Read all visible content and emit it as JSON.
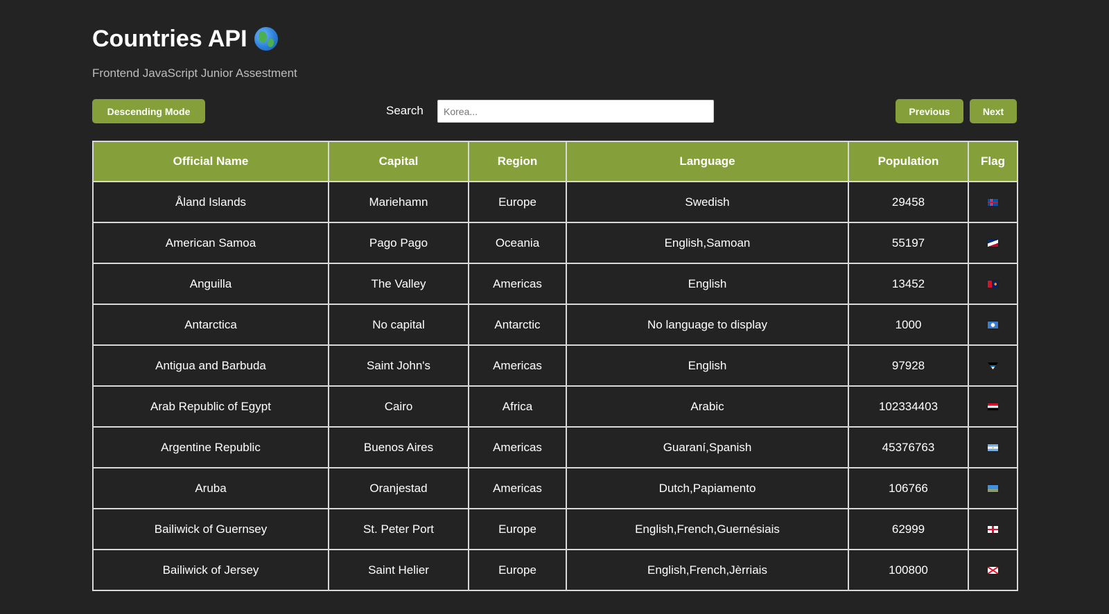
{
  "header": {
    "title": "Countries API",
    "globe_icon": "globe-americas-icon",
    "subtitle": "Frontend JavaScript Junior Assestment"
  },
  "controls": {
    "sort_button_label": "Descending Mode",
    "search_label": "Search",
    "search_placeholder": "Korea...",
    "search_value": "",
    "previous_label": "Previous",
    "next_label": "Next"
  },
  "colors": {
    "accent": "#85a03a",
    "background": "#232323",
    "border": "#d9d9d9"
  },
  "table": {
    "columns": [
      "Official Name",
      "Capital",
      "Region",
      "Language",
      "Population",
      "Flag"
    ],
    "rows": [
      {
        "name": "Åland Islands",
        "capital": "Mariehamn",
        "region": "Europe",
        "language": "Swedish",
        "population": "29458",
        "flag": "aland-flag-icon"
      },
      {
        "name": "American Samoa",
        "capital": "Pago Pago",
        "region": "Oceania",
        "language": "English,Samoan",
        "population": "55197",
        "flag": "american-samoa-flag-icon"
      },
      {
        "name": "Anguilla",
        "capital": "The Valley",
        "region": "Americas",
        "language": "English",
        "population": "13452",
        "flag": "anguilla-flag-icon"
      },
      {
        "name": "Antarctica",
        "capital": "No capital",
        "region": "Antarctic",
        "language": "No language to display",
        "population": "1000",
        "flag": "antarctica-flag-icon"
      },
      {
        "name": "Antigua and Barbuda",
        "capital": "Saint John's",
        "region": "Americas",
        "language": "English",
        "population": "97928",
        "flag": "antigua-barbuda-flag-icon"
      },
      {
        "name": "Arab Republic of Egypt",
        "capital": "Cairo",
        "region": "Africa",
        "language": "Arabic",
        "population": "102334403",
        "flag": "egypt-flag-icon"
      },
      {
        "name": "Argentine Republic",
        "capital": "Buenos Aires",
        "region": "Americas",
        "language": "Guaraní,Spanish",
        "population": "45376763",
        "flag": "argentina-flag-icon"
      },
      {
        "name": "Aruba",
        "capital": "Oranjestad",
        "region": "Americas",
        "language": "Dutch,Papiamento",
        "population": "106766",
        "flag": "aruba-flag-icon"
      },
      {
        "name": "Bailiwick of Guernsey",
        "capital": "St. Peter Port",
        "region": "Europe",
        "language": "English,French,Guernésiais",
        "population": "62999",
        "flag": "guernsey-flag-icon"
      },
      {
        "name": "Bailiwick of Jersey",
        "capital": "Saint Helier",
        "region": "Europe",
        "language": "English,French,Jèrriais",
        "population": "100800",
        "flag": "jersey-flag-icon"
      }
    ]
  }
}
